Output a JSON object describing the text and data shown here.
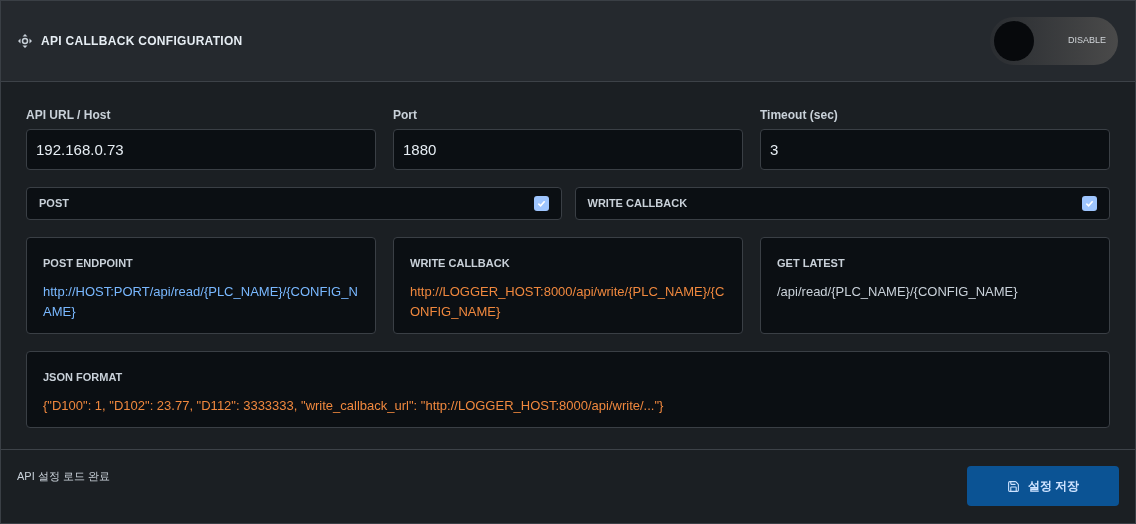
{
  "header": {
    "title": "API CALLBACK CONFIGURATION",
    "toggle": {
      "label": "DISABLE",
      "on": false
    }
  },
  "fields": [
    {
      "label": "API URL / Host",
      "value": "192.168.0.73"
    },
    {
      "label": "Port",
      "value": "1880"
    },
    {
      "label": "Timeout (sec)",
      "value": "3"
    }
  ],
  "options": [
    {
      "label": "POST",
      "checked": true
    },
    {
      "label": "WRITE CALLBACK",
      "checked": true
    }
  ],
  "cards": [
    {
      "title": "POST ENDPOINT",
      "value": "http://HOST:PORT/api/read/{PLC_NAME}/{CONFIG_NAME}",
      "color": "#79b8ff"
    },
    {
      "title": "WRITE CALLBACK",
      "value": "http://LOGGER_HOST:8000/api/write/{PLC_NAME}/{CONFIG_NAME}",
      "color": "#f0883e"
    },
    {
      "title": "GET LATEST",
      "value": "/api/read/{PLC_NAME}/{CONFIG_NAME}",
      "color": "#c9d1d9"
    }
  ],
  "json_format": {
    "title": "JSON FORMAT",
    "value": "{\"D100\": 1, \"D102\": 23.77, \"D112\": 3333333, \"write_callback_url\": \"http://LOGGER_HOST:8000/api/write/...\"}",
    "color": "#f0883e"
  },
  "footer": {
    "status": "API 설정 로드 완료",
    "save_button": "설정 저장"
  }
}
